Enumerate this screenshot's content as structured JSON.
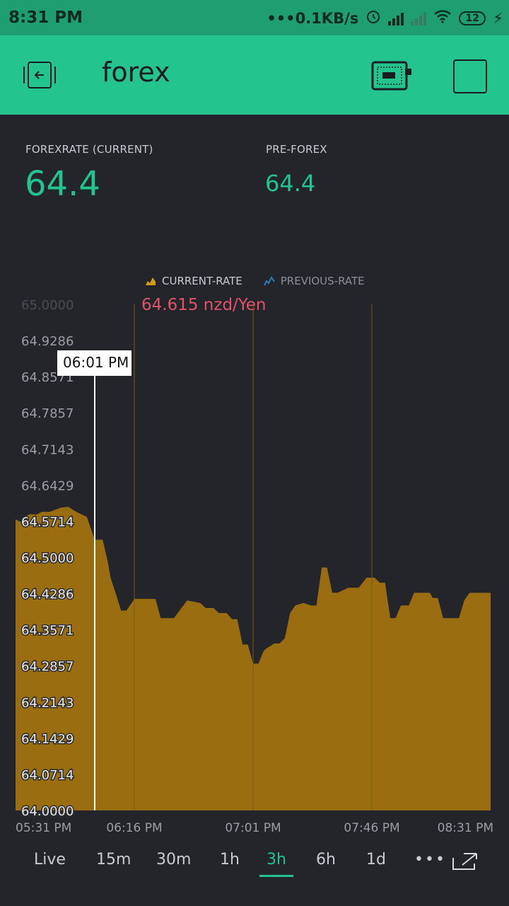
{
  "status_bar": {
    "time": "8:31 PM",
    "net_speed": "0.1KB/s",
    "battery": "12"
  },
  "app_bar": {
    "title": "forex"
  },
  "metrics": [
    {
      "label": "FOREXRATE (CURRENT)",
      "value": "64.4"
    },
    {
      "label": "PRE-FOREX",
      "value": "64.4"
    }
  ],
  "legend": [
    {
      "name": "CURRENT-RATE",
      "active": true,
      "color": "#a1720f"
    },
    {
      "name": "PREVIOUS-RATE",
      "active": false,
      "color": "#2d7fb3"
    }
  ],
  "tooltip": {
    "time": "06:01 PM",
    "value": "64.615 nzd/Yen"
  },
  "chart_data": {
    "type": "area",
    "series": [
      {
        "name": "CURRENT-RATE",
        "x_minutes": [
          0,
          2,
          5,
          8,
          10,
          13,
          17,
          20,
          23,
          27,
          30,
          33,
          35,
          36,
          38,
          40,
          42,
          44,
          45,
          47,
          50,
          53,
          55,
          60,
          65,
          70,
          72,
          75,
          77,
          80,
          82,
          84,
          86,
          88,
          90,
          92,
          94,
          95,
          98,
          100,
          102,
          104,
          106,
          109,
          112,
          114,
          116,
          118,
          120,
          122,
          124,
          126,
          130,
          133,
          136,
          138,
          140,
          142,
          144,
          146,
          149,
          151,
          154,
          157,
          158,
          160,
          162,
          165,
          168,
          170,
          172,
          174,
          176,
          178,
          180
        ],
        "values": [
          64.575,
          64.57,
          64.585,
          64.585,
          64.59,
          64.59,
          64.598,
          64.6,
          64.59,
          64.58,
          64.535,
          64.535,
          64.49,
          64.46,
          64.428,
          64.395,
          64.395,
          64.41,
          64.418,
          64.418,
          64.418,
          64.418,
          64.38,
          64.38,
          64.415,
          64.41,
          64.4,
          64.4,
          64.39,
          64.39,
          64.378,
          64.378,
          64.328,
          64.328,
          64.29,
          64.29,
          64.315,
          64.32,
          64.33,
          64.33,
          64.34,
          64.39,
          64.405,
          64.41,
          64.405,
          64.405,
          64.48,
          64.48,
          64.43,
          64.43,
          64.435,
          64.44,
          64.44,
          64.46,
          64.46,
          64.45,
          64.45,
          64.38,
          64.38,
          64.405,
          64.405,
          64.43,
          64.43,
          64.43,
          64.42,
          64.42,
          64.38,
          64.38,
          64.38,
          64.415,
          64.43,
          64.43,
          64.43,
          64.43,
          64.43
        ]
      }
    ],
    "ylim": [
      64.0,
      65.0
    ],
    "y_ticks": [
      "65.0000",
      "64.9286",
      "64.8571",
      "64.7857",
      "64.7143",
      "64.6429",
      "64.5714",
      "64.5000",
      "64.4286",
      "64.3571",
      "64.2857",
      "64.2143",
      "64.1429",
      "64.0714",
      "64.0000"
    ],
    "x_ticks": [
      "05:31 PM",
      "06:16 PM",
      "07:01 PM",
      "07:46 PM",
      "08:31 PM"
    ],
    "cursor_minute": 30,
    "grid": true
  },
  "range_tabs": [
    {
      "label": "Live",
      "active": false
    },
    {
      "label": "15m",
      "active": false
    },
    {
      "label": "30m",
      "active": false
    },
    {
      "label": "1h",
      "active": false
    },
    {
      "label": "3h",
      "active": true
    },
    {
      "label": "6h",
      "active": false
    },
    {
      "label": "1d",
      "active": false
    }
  ],
  "icons": {
    "back": "back-icon",
    "device": "device-icon",
    "square": "square-icon",
    "more": "more-icon",
    "expand": "expand-icon"
  },
  "colors": {
    "accent": "#23c48e",
    "area_fill": "#a1720f",
    "tooltip_value": "#e2526b",
    "background": "#23252b"
  }
}
